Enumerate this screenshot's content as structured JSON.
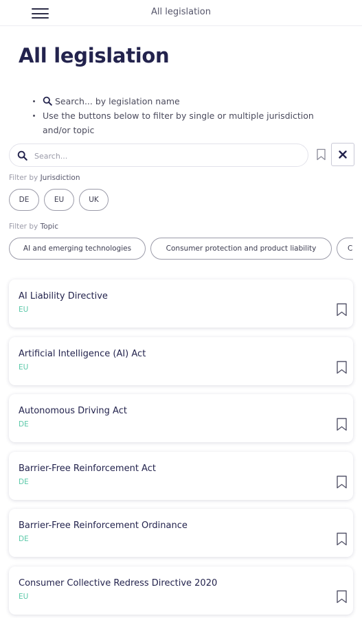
{
  "header": {
    "title": "All legislation"
  },
  "page": {
    "title": "All legislation"
  },
  "help": {
    "line1": "Search... by legislation name",
    "line2": "Use the buttons below to filter by single or multiple jurisdiction and/or topic"
  },
  "search": {
    "placeholder": "Search..."
  },
  "filters": {
    "jurisdiction_prefix": "Filter by",
    "jurisdiction_label": "Jurisdiction",
    "jurisdictions": [
      "DE",
      "EU",
      "UK"
    ],
    "topic_prefix": "Filter by",
    "topic_label": "Topic",
    "topics": [
      "AI and emerging technologies",
      "Consumer protection and product liability",
      "C"
    ]
  },
  "legislation": [
    {
      "title": "AI Liability Directive",
      "jurisdiction": "EU"
    },
    {
      "title": "Artificial Intelligence (AI) Act",
      "jurisdiction": "EU"
    },
    {
      "title": "Autonomous Driving Act",
      "jurisdiction": "DE"
    },
    {
      "title": "Barrier-Free Reinforcement Act",
      "jurisdiction": "DE"
    },
    {
      "title": "Barrier-Free Reinforcement Ordinance",
      "jurisdiction": "DE"
    },
    {
      "title": "Consumer Collective Redress Directive 2020",
      "jurisdiction": "EU"
    }
  ],
  "colors": {
    "title": "#23234d",
    "jurisdiction_tag": "#5ac8a8",
    "chip_border": "#9a9aa8"
  },
  "icons": {
    "menu": "hamburger-icon",
    "search": "search-icon",
    "bookmark": "bookmark-icon",
    "clear": "close-icon"
  }
}
